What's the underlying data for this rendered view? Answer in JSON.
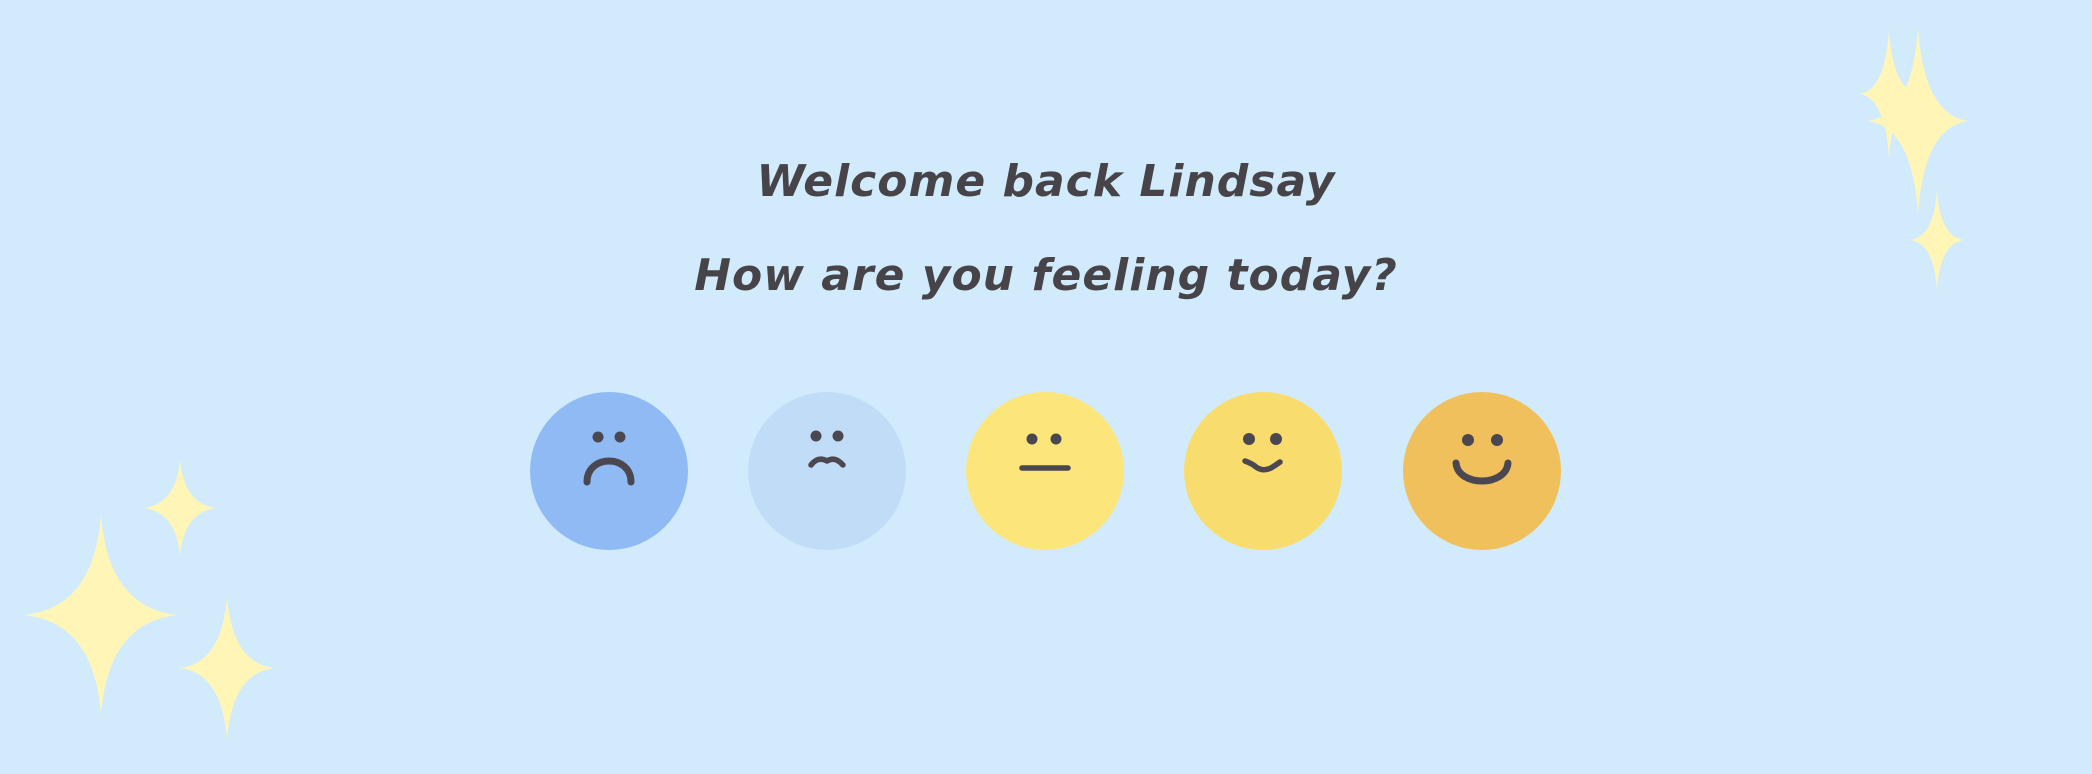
{
  "greeting": {
    "welcome": "Welcome back Lindsay",
    "question": "How are you feeling today?"
  },
  "colors": {
    "background": "#d2ebfc",
    "text": "#464448",
    "sparkle": "#fff5b6",
    "face_features": "#4b4750"
  },
  "moods": [
    {
      "icon": "very-sad-face-icon",
      "color": "#8fbaf3"
    },
    {
      "icon": "sad-face-icon",
      "color": "#c1dcf7"
    },
    {
      "icon": "neutral-face-icon",
      "color": "#fce57a"
    },
    {
      "icon": "happy-face-icon",
      "color": "#f9dc6e"
    },
    {
      "icon": "very-happy-face-icon",
      "color": "#f0c05d"
    }
  ]
}
